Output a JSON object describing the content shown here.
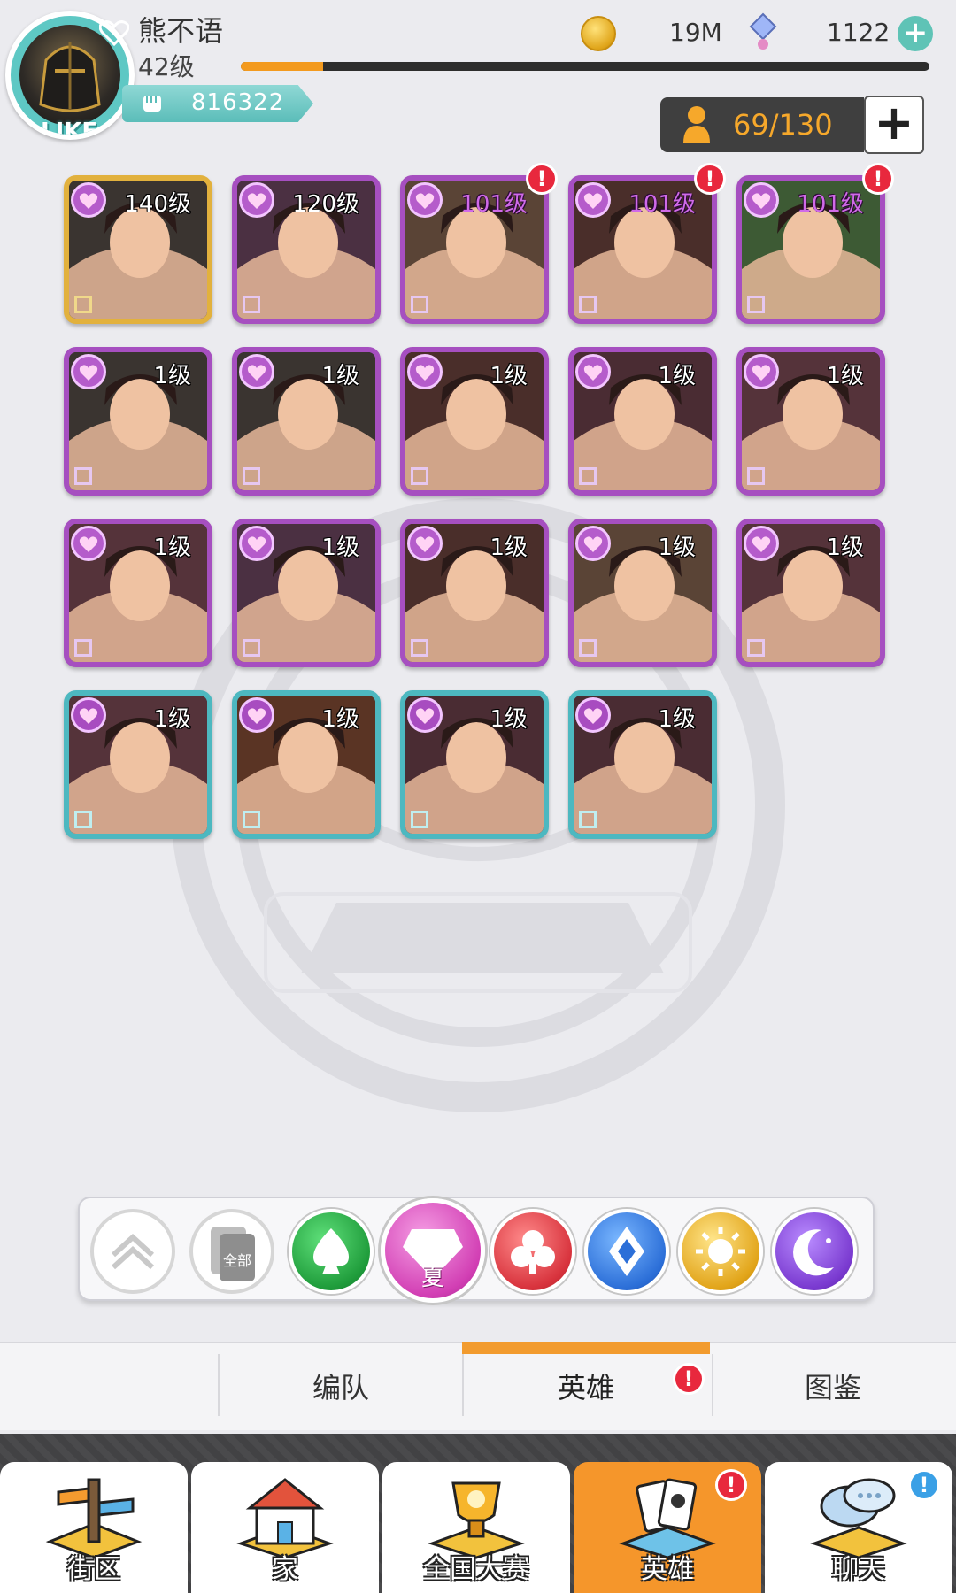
{
  "player": {
    "name": "熊不语",
    "level": "42级",
    "avatar_badge": "LIKE",
    "power": "816322",
    "xp_progress": 0.12
  },
  "currency": {
    "coins": "19M",
    "gems": "1122"
  },
  "roster": {
    "count": "69/130"
  },
  "heroes": [
    {
      "level": "140级",
      "frame": "gold",
      "art": "armored-knight",
      "alert": false
    },
    {
      "level": "120级",
      "frame": "purple",
      "art": "headscarf-woman",
      "alert": false
    },
    {
      "level": "101级",
      "frame": "purple",
      "art": "tattooed-fighter",
      "alert": true
    },
    {
      "level": "101级",
      "frame": "purple",
      "art": "red-hair-girl",
      "alert": true
    },
    {
      "level": "101级",
      "frame": "purple",
      "art": "white-beard-elder",
      "alert": true
    },
    {
      "level": "1级",
      "frame": "purple",
      "art": "armored-knight",
      "alert": false
    },
    {
      "level": "1级",
      "frame": "purple",
      "art": "armored-knight",
      "alert": false
    },
    {
      "level": "1级",
      "frame": "purple",
      "art": "red-hair-girl",
      "alert": false
    },
    {
      "level": "1级",
      "frame": "purple",
      "art": "grinning-brawler",
      "alert": false
    },
    {
      "level": "1级",
      "frame": "purple",
      "art": "long-hair-man",
      "alert": false
    },
    {
      "level": "1级",
      "frame": "purple",
      "art": "long-hair-man",
      "alert": false
    },
    {
      "level": "1级",
      "frame": "purple",
      "art": "headscarf-woman",
      "alert": false
    },
    {
      "level": "1级",
      "frame": "purple",
      "art": "red-hair-girl",
      "alert": false
    },
    {
      "level": "1级",
      "frame": "purple",
      "art": "tattooed-fighter",
      "alert": false
    },
    {
      "level": "1级",
      "frame": "purple",
      "art": "long-hair-man",
      "alert": false
    },
    {
      "level": "1级",
      "frame": "cyan",
      "art": "long-hair-man",
      "alert": false
    },
    {
      "level": "1级",
      "frame": "cyan",
      "art": "wild-hair-brute",
      "alert": false
    },
    {
      "level": "1级",
      "frame": "cyan",
      "art": "grinning-brawler",
      "alert": false
    },
    {
      "level": "1级",
      "frame": "cyan",
      "art": "grinning-brawler",
      "alert": false
    }
  ],
  "filters": [
    {
      "icon": "chevron-up-icon",
      "label": ""
    },
    {
      "icon": "all-cards-icon",
      "label": "全部"
    },
    {
      "icon": "spade-icon",
      "label": ""
    },
    {
      "icon": "diamond-icon",
      "label": "夏",
      "selected": true
    },
    {
      "icon": "club-icon",
      "label": ""
    },
    {
      "icon": "rhombus-icon",
      "label": ""
    },
    {
      "icon": "sun-icon",
      "label": ""
    },
    {
      "icon": "moon-icon",
      "label": ""
    }
  ],
  "subtabs": [
    {
      "label": "编队",
      "active": false,
      "alert": false
    },
    {
      "label": "英雄",
      "active": true,
      "alert": true
    },
    {
      "label": "图鉴",
      "active": false,
      "alert": false
    }
  ],
  "nav": [
    {
      "label": "街区",
      "icon": "signpost-icon",
      "active": false
    },
    {
      "label": "家",
      "icon": "house-icon",
      "active": false
    },
    {
      "label": "全国大赛",
      "icon": "trophy-icon",
      "active": false
    },
    {
      "label": "英雄",
      "icon": "hero-cards-icon",
      "active": true,
      "alert": "!"
    },
    {
      "label": "聊天",
      "icon": "chat-bubbles-icon",
      "active": false,
      "alert": "!"
    }
  ],
  "colors": {
    "accent_orange": "#f5962b",
    "frame_gold": "#e2b13d",
    "frame_purple": "#a64fc0",
    "frame_cyan": "#4db8c0",
    "alert_red": "#e8283d"
  }
}
